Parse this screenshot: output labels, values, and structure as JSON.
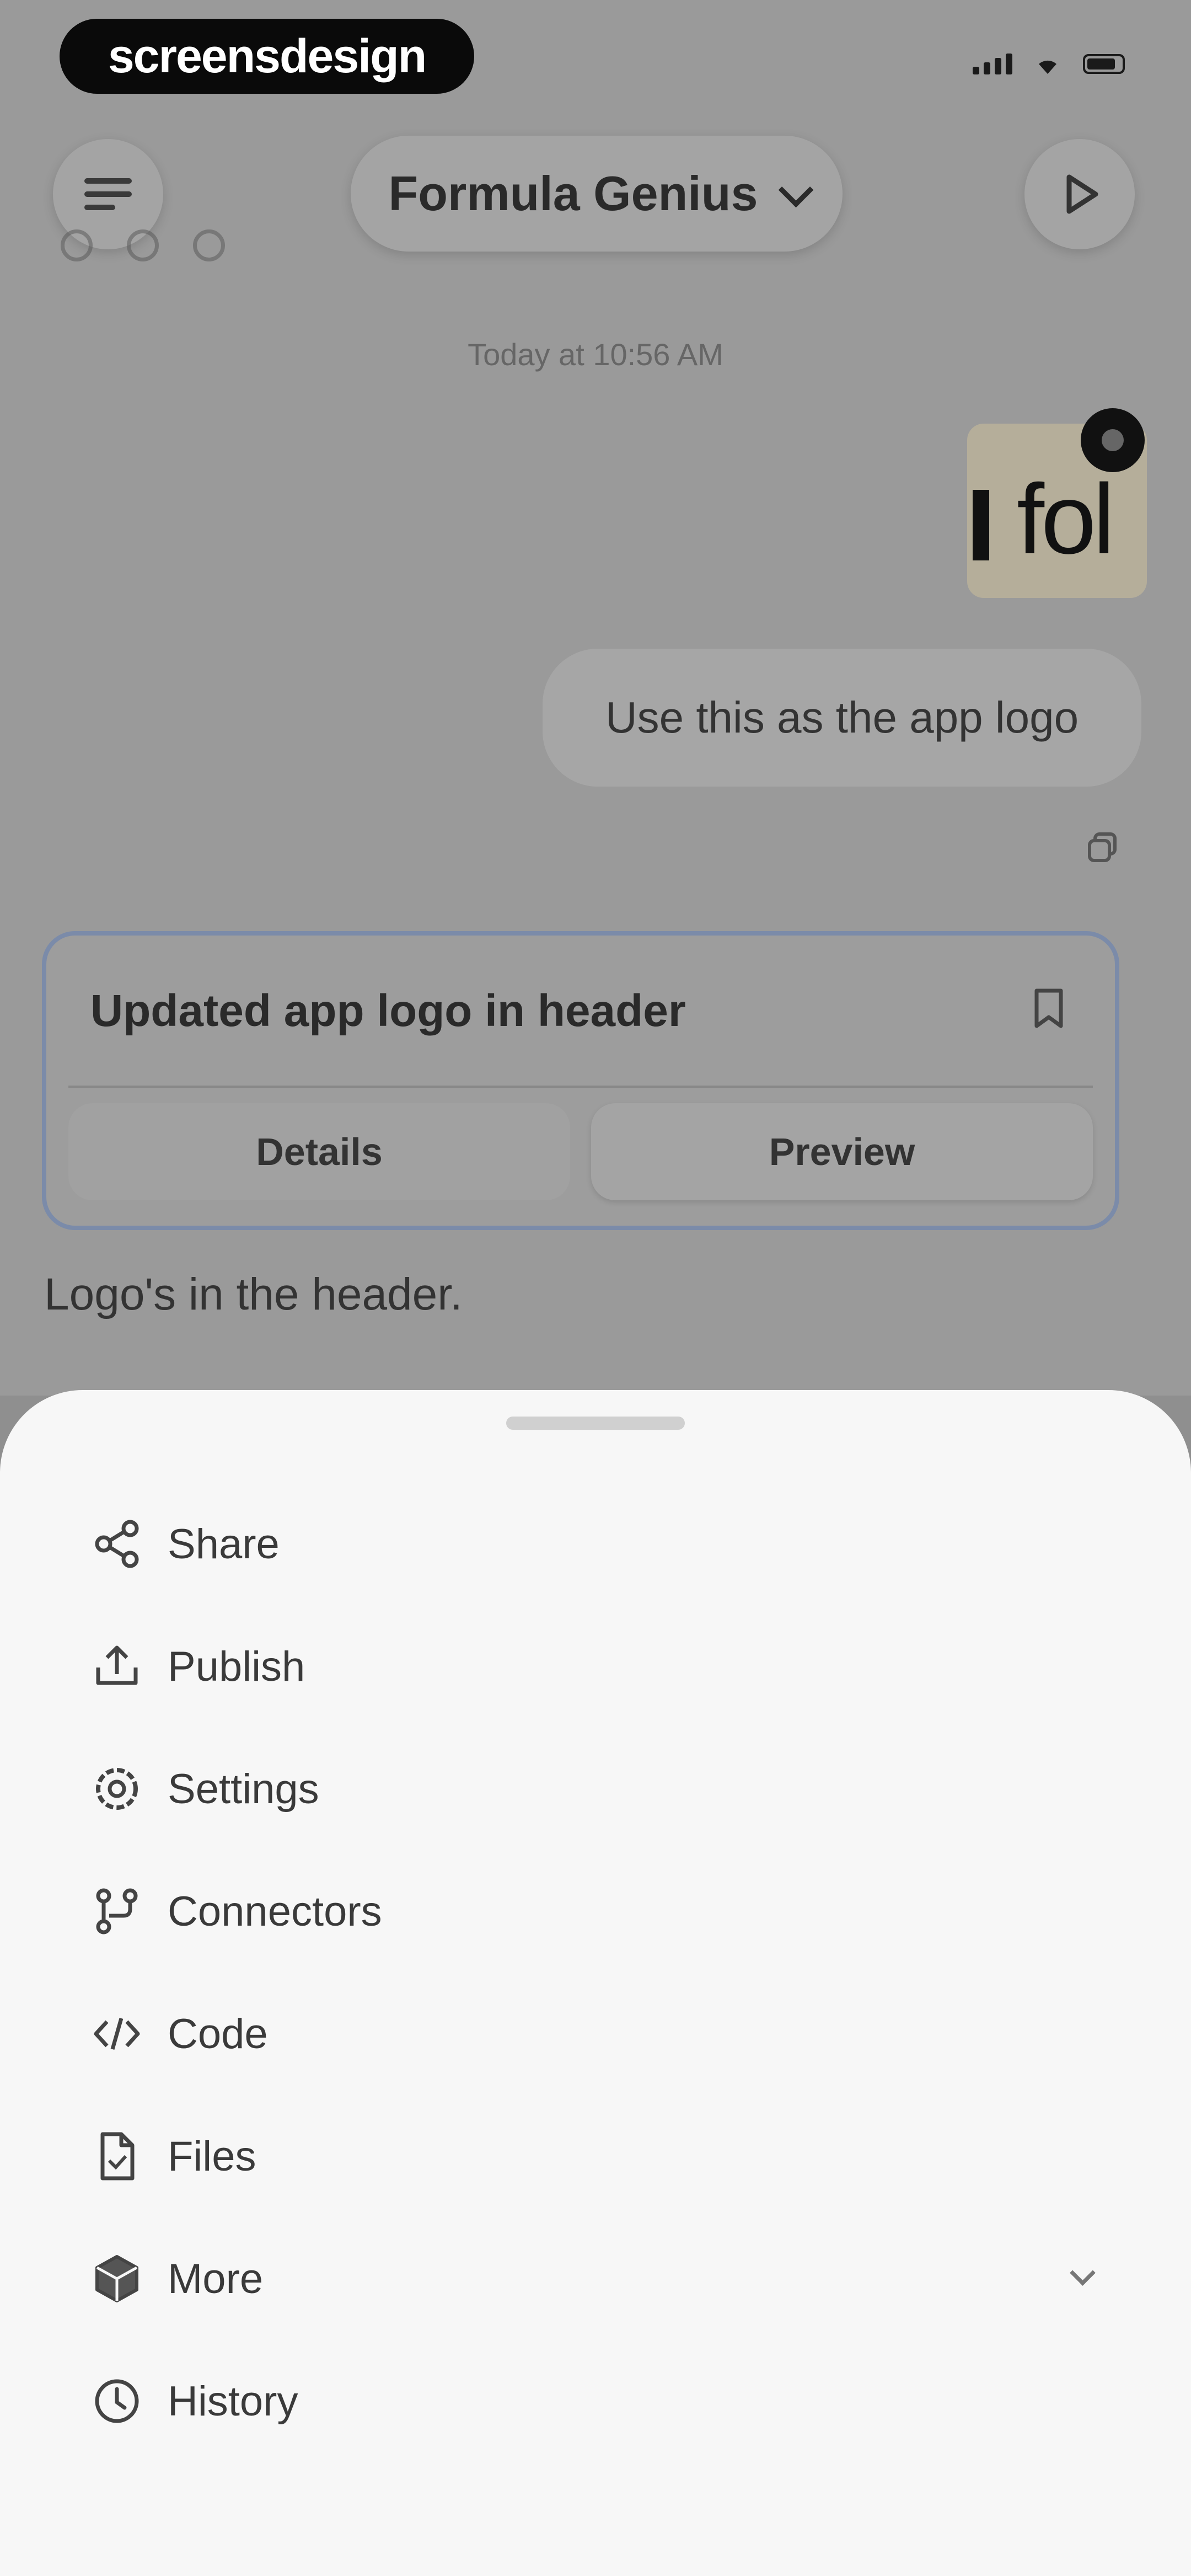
{
  "watermark": {
    "text": "screensdesign"
  },
  "header": {
    "title": "Formula Genius"
  },
  "chat": {
    "timestamp": "Today at 10:56 AM",
    "attachment_logo_text": "fol",
    "user_message": "Use this as the app logo",
    "card": {
      "title": "Updated app logo in header",
      "details_label": "Details",
      "preview_label": "Preview"
    },
    "assistant_message": "Logo's in the header."
  },
  "sheet": {
    "items": [
      {
        "label": "Share",
        "icon": "share-icon"
      },
      {
        "label": "Publish",
        "icon": "publish-icon"
      },
      {
        "label": "Settings",
        "icon": "settings-icon"
      },
      {
        "label": "Connectors",
        "icon": "connectors-icon"
      },
      {
        "label": "Code",
        "icon": "code-icon"
      },
      {
        "label": "Files",
        "icon": "file-icon"
      },
      {
        "label": "More",
        "icon": "cube-icon"
      },
      {
        "label": "History",
        "icon": "history-icon"
      }
    ]
  },
  "colors": {
    "sheet_bg": "#f7f7f7",
    "card_border": "#7b8ba9",
    "overlay_bg": "#9a9a9a"
  }
}
